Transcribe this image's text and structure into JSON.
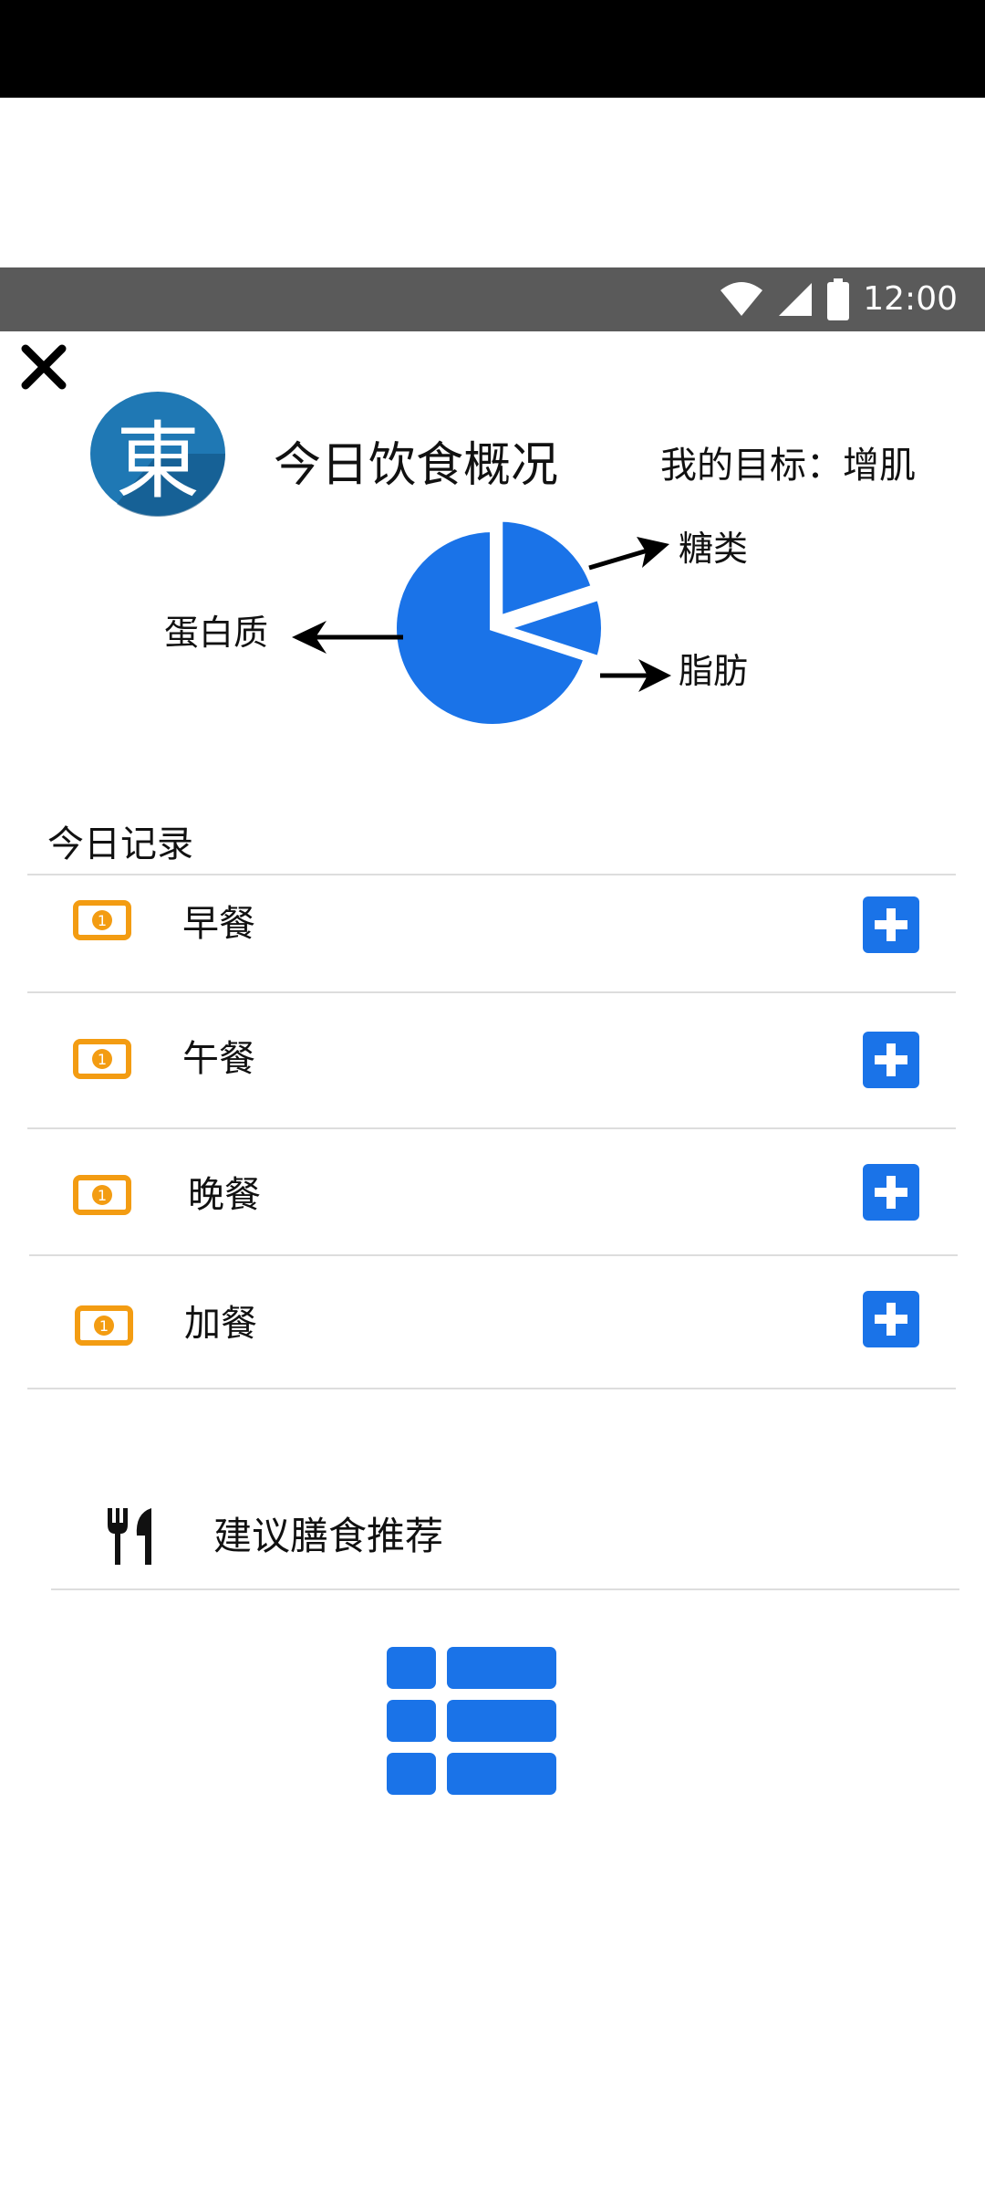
{
  "status": {
    "time": "12:00"
  },
  "header": {
    "logo_char": "東",
    "title": "今日饮食概况",
    "goal_label": "我的目标：增肌"
  },
  "chart_data": {
    "type": "pie",
    "categories": [
      "蛋白质",
      "糖类",
      "脂肪"
    ],
    "values": [
      70,
      20,
      10
    ],
    "colors": [
      "#1a73e8",
      "#1a73e8",
      "#1a73e8"
    ]
  },
  "records": {
    "section_title": "今日记录",
    "meals": [
      {
        "label": "早餐"
      },
      {
        "label": "午餐"
      },
      {
        "label": "晚餐"
      },
      {
        "label": "加餐"
      }
    ]
  },
  "recommend": {
    "label": "建议膳食推荐"
  },
  "colors": {
    "accent": "#1a73e8",
    "meal_icon": "#f39c12",
    "logo_bg": "#1f78b4"
  }
}
